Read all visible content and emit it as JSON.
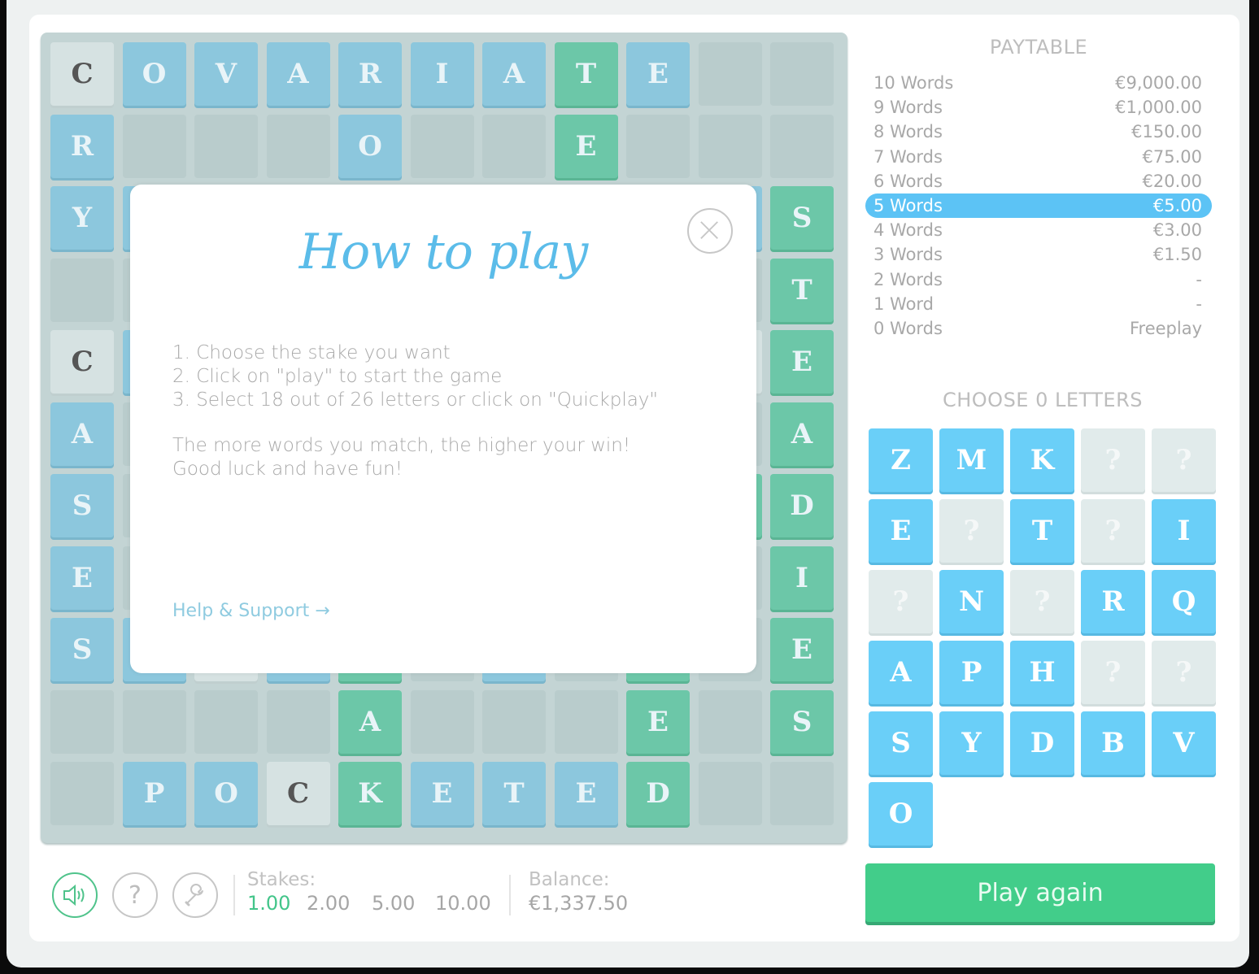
{
  "board": {
    "rows": [
      [
        {
          "t": "light",
          "l": "C"
        },
        {
          "t": "blue",
          "l": "O"
        },
        {
          "t": "blue",
          "l": "V"
        },
        {
          "t": "blue",
          "l": "A"
        },
        {
          "t": "blue",
          "l": "R"
        },
        {
          "t": "blue",
          "l": "I"
        },
        {
          "t": "blue",
          "l": "A"
        },
        {
          "t": "green",
          "l": "T"
        },
        {
          "t": "blue",
          "l": "E"
        },
        {
          "t": "empty",
          "l": ""
        },
        {
          "t": "empty",
          "l": ""
        }
      ],
      [
        {
          "t": "blue",
          "l": "R"
        },
        {
          "t": "empty",
          "l": ""
        },
        {
          "t": "empty",
          "l": ""
        },
        {
          "t": "empty",
          "l": ""
        },
        {
          "t": "blue",
          "l": "O"
        },
        {
          "t": "empty",
          "l": ""
        },
        {
          "t": "empty",
          "l": ""
        },
        {
          "t": "green",
          "l": "E"
        },
        {
          "t": "empty",
          "l": ""
        },
        {
          "t": "empty",
          "l": ""
        },
        {
          "t": "empty",
          "l": ""
        }
      ],
      [
        {
          "t": "blue",
          "l": "Y"
        },
        {
          "t": "blue",
          "l": ""
        },
        {
          "t": "empty",
          "l": ""
        },
        {
          "t": "empty",
          "l": ""
        },
        {
          "t": "empty",
          "l": ""
        },
        {
          "t": "empty",
          "l": ""
        },
        {
          "t": "empty",
          "l": ""
        },
        {
          "t": "empty",
          "l": ""
        },
        {
          "t": "empty",
          "l": ""
        },
        {
          "t": "blue",
          "l": ""
        },
        {
          "t": "green",
          "l": "S"
        }
      ],
      [
        {
          "t": "empty",
          "l": ""
        },
        {
          "t": "empty",
          "l": ""
        },
        {
          "t": "empty",
          "l": ""
        },
        {
          "t": "empty",
          "l": ""
        },
        {
          "t": "empty",
          "l": ""
        },
        {
          "t": "empty",
          "l": ""
        },
        {
          "t": "empty",
          "l": ""
        },
        {
          "t": "empty",
          "l": ""
        },
        {
          "t": "empty",
          "l": ""
        },
        {
          "t": "empty",
          "l": ""
        },
        {
          "t": "green",
          "l": "T"
        }
      ],
      [
        {
          "t": "light",
          "l": "C"
        },
        {
          "t": "blue",
          "l": ""
        },
        {
          "t": "empty",
          "l": ""
        },
        {
          "t": "empty",
          "l": ""
        },
        {
          "t": "empty",
          "l": ""
        },
        {
          "t": "empty",
          "l": ""
        },
        {
          "t": "empty",
          "l": ""
        },
        {
          "t": "empty",
          "l": ""
        },
        {
          "t": "empty",
          "l": ""
        },
        {
          "t": "light",
          "l": ""
        },
        {
          "t": "green",
          "l": "E"
        }
      ],
      [
        {
          "t": "blue",
          "l": "A"
        },
        {
          "t": "empty",
          "l": ""
        },
        {
          "t": "empty",
          "l": ""
        },
        {
          "t": "empty",
          "l": ""
        },
        {
          "t": "empty",
          "l": ""
        },
        {
          "t": "empty",
          "l": ""
        },
        {
          "t": "empty",
          "l": ""
        },
        {
          "t": "empty",
          "l": ""
        },
        {
          "t": "empty",
          "l": ""
        },
        {
          "t": "empty",
          "l": ""
        },
        {
          "t": "green",
          "l": "A"
        }
      ],
      [
        {
          "t": "blue",
          "l": "S"
        },
        {
          "t": "empty",
          "l": ""
        },
        {
          "t": "empty",
          "l": ""
        },
        {
          "t": "empty",
          "l": ""
        },
        {
          "t": "empty",
          "l": ""
        },
        {
          "t": "empty",
          "l": ""
        },
        {
          "t": "empty",
          "l": ""
        },
        {
          "t": "empty",
          "l": ""
        },
        {
          "t": "empty",
          "l": ""
        },
        {
          "t": "green",
          "l": ""
        },
        {
          "t": "green",
          "l": "D"
        }
      ],
      [
        {
          "t": "blue",
          "l": "E"
        },
        {
          "t": "empty",
          "l": ""
        },
        {
          "t": "empty",
          "l": ""
        },
        {
          "t": "empty",
          "l": ""
        },
        {
          "t": "empty",
          "l": ""
        },
        {
          "t": "empty",
          "l": ""
        },
        {
          "t": "empty",
          "l": ""
        },
        {
          "t": "empty",
          "l": ""
        },
        {
          "t": "empty",
          "l": ""
        },
        {
          "t": "empty",
          "l": ""
        },
        {
          "t": "green",
          "l": "I"
        }
      ],
      [
        {
          "t": "blue",
          "l": "S"
        },
        {
          "t": "blue",
          "l": ""
        },
        {
          "t": "light",
          "l": ""
        },
        {
          "t": "blue",
          "l": ""
        },
        {
          "t": "green",
          "l": ""
        },
        {
          "t": "empty",
          "l": ""
        },
        {
          "t": "blue",
          "l": ""
        },
        {
          "t": "empty",
          "l": ""
        },
        {
          "t": "green",
          "l": ""
        },
        {
          "t": "empty",
          "l": ""
        },
        {
          "t": "green",
          "l": "E"
        }
      ],
      [
        {
          "t": "empty",
          "l": ""
        },
        {
          "t": "empty",
          "l": ""
        },
        {
          "t": "empty",
          "l": ""
        },
        {
          "t": "empty",
          "l": ""
        },
        {
          "t": "green",
          "l": "A"
        },
        {
          "t": "empty",
          "l": ""
        },
        {
          "t": "empty",
          "l": ""
        },
        {
          "t": "empty",
          "l": ""
        },
        {
          "t": "green",
          "l": "E"
        },
        {
          "t": "empty",
          "l": ""
        },
        {
          "t": "green",
          "l": "S"
        }
      ],
      [
        {
          "t": "empty",
          "l": ""
        },
        {
          "t": "blue",
          "l": "P"
        },
        {
          "t": "blue",
          "l": "O"
        },
        {
          "t": "light",
          "l": "C"
        },
        {
          "t": "green",
          "l": "K"
        },
        {
          "t": "blue",
          "l": "E"
        },
        {
          "t": "blue",
          "l": "T"
        },
        {
          "t": "blue",
          "l": "E"
        },
        {
          "t": "green",
          "l": "D"
        },
        {
          "t": "empty",
          "l": ""
        },
        {
          "t": "empty",
          "l": ""
        }
      ]
    ]
  },
  "modal": {
    "title": "How to play",
    "close_icon": "close-circle-icon",
    "steps": [
      "1. Choose the stake you want",
      "2. Click on \"play\" to start the game",
      "3. Select 18 out of 26 letters or click on \"Quickplay\""
    ],
    "paragraph": [
      "The more words you match, the higher your win!",
      "Good luck and have fun!"
    ],
    "help_link": "Help & Support →"
  },
  "paytable": {
    "title": "PAYTABLE",
    "active_index": 5,
    "rows": [
      {
        "label": "10 Words",
        "value": "€9,000.00"
      },
      {
        "label": "9 Words",
        "value": "€1,000.00"
      },
      {
        "label": "8 Words",
        "value": "€150.00"
      },
      {
        "label": "7 Words",
        "value": "€75.00"
      },
      {
        "label": "6 Words",
        "value": "€20.00"
      },
      {
        "label": "5 Words",
        "value": "€5.00"
      },
      {
        "label": "4 Words",
        "value": "€3.00"
      },
      {
        "label": "3 Words",
        "value": "€1.50"
      },
      {
        "label": "2 Words",
        "value": "-"
      },
      {
        "label": "1 Word",
        "value": "-"
      },
      {
        "label": "0 Words",
        "value": "Freeplay"
      }
    ]
  },
  "letters": {
    "title": "CHOOSE 0 LETTERS",
    "tiles": [
      {
        "l": "Z",
        "on": true
      },
      {
        "l": "M",
        "on": true
      },
      {
        "l": "K",
        "on": true
      },
      {
        "l": "?",
        "on": false
      },
      {
        "l": "?",
        "on": false
      },
      {
        "l": "E",
        "on": true
      },
      {
        "l": "?",
        "on": false
      },
      {
        "l": "T",
        "on": true
      },
      {
        "l": "?",
        "on": false
      },
      {
        "l": "I",
        "on": true
      },
      {
        "l": "?",
        "on": false
      },
      {
        "l": "N",
        "on": true
      },
      {
        "l": "?",
        "on": false
      },
      {
        "l": "R",
        "on": true
      },
      {
        "l": "Q",
        "on": true
      },
      {
        "l": "A",
        "on": true
      },
      {
        "l": "P",
        "on": true
      },
      {
        "l": "H",
        "on": true
      },
      {
        "l": "?",
        "on": false
      },
      {
        "l": "?",
        "on": false
      },
      {
        "l": "S",
        "on": true
      },
      {
        "l": "Y",
        "on": true
      },
      {
        "l": "D",
        "on": true
      },
      {
        "l": "B",
        "on": true
      },
      {
        "l": "V",
        "on": true
      },
      {
        "l": "O",
        "on": true
      }
    ]
  },
  "play_button": "Play again",
  "controls": {
    "sound_icon": "speaker-icon",
    "help_icon": "question-icon",
    "settings_icon": "wrench-icon",
    "stakes_label": "Stakes:",
    "stakes": [
      "1.00",
      "2.00",
      "5.00",
      "10.00"
    ],
    "active_stake": 0,
    "balance_label": "Balance:",
    "balance": "€1,337.50"
  },
  "colors": {
    "blue_tile": "#8cc7dd",
    "green_tile": "#6cc7a8",
    "light_tile": "#d6e2e2",
    "accent_blue": "#5cc3f5",
    "accent_green": "#42cd8a"
  }
}
